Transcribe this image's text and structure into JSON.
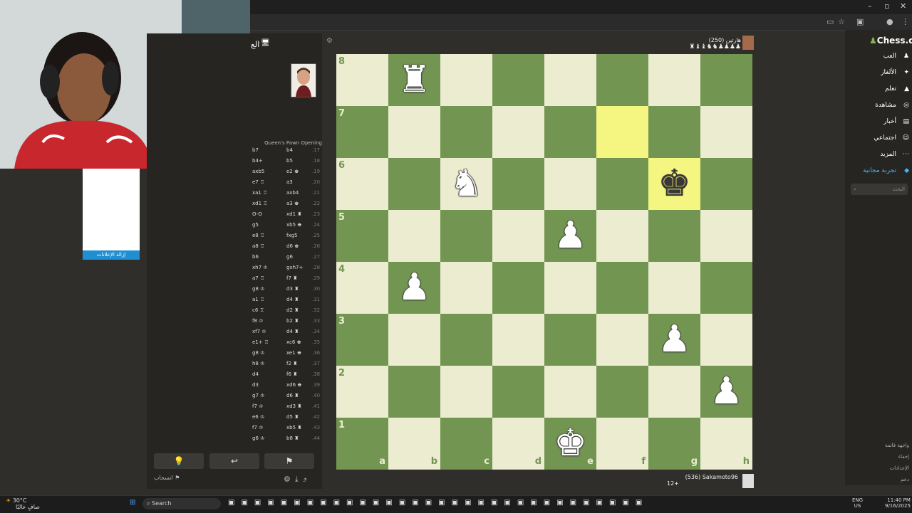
{
  "opponent": {
    "name": "هارتين (250)",
    "captured": "♜♝♝♞♞♟♟♟♟"
  },
  "player": {
    "name": "(536) Sakamoto96",
    "rating_note": "12+"
  },
  "opening_name": "Queen's Pawn Opening",
  "panel_title": "الع",
  "ad_button": "إزالة الإعلانات",
  "moves": [
    {
      "n": ".17",
      "w": "b4",
      "b": "b7"
    },
    {
      "n": ".18",
      "w": "b5",
      "b": "b4+"
    },
    {
      "n": ".19",
      "w": "e2 ♚",
      "b": "axb5"
    },
    {
      "n": ".20",
      "w": "a3",
      "b": "e7 ♖"
    },
    {
      "n": ".21",
      "w": "axb4",
      "b": "xa1 ♖"
    },
    {
      "n": ".22",
      "w": "a3 ♚",
      "b": "xd1 ♖"
    },
    {
      "n": ".23",
      "w": "xd1 ♜",
      "b": "O-O"
    },
    {
      "n": ".24",
      "w": "xb5 ♚",
      "b": "g5"
    },
    {
      "n": ".25",
      "w": "fxg5",
      "b": "e8 ♖"
    },
    {
      "n": ".26",
      "w": "d6 ♚",
      "b": "a8 ♖"
    },
    {
      "n": ".27",
      "w": "g6",
      "b": "b6"
    },
    {
      "n": ".28",
      "w": "gxh7+",
      "b": "xh7 ♔"
    },
    {
      "n": ".29",
      "w": "f7 ♜",
      "b": "a7 ♖"
    },
    {
      "n": ".30",
      "w": "d3 ♜",
      "b": "g8 ♔"
    },
    {
      "n": ".31",
      "w": "d4 ♜",
      "b": "a1 ♖"
    },
    {
      "n": ".32",
      "w": "d2 ♜",
      "b": "c6 ♖"
    },
    {
      "n": ".33",
      "w": "b2 ♜",
      "b": "f8 ♔"
    },
    {
      "n": ".34",
      "w": "d4 ♜",
      "b": "xf7 ♔"
    },
    {
      "n": ".35",
      "w": "xc6 ♚",
      "b": "e1+ ♖"
    },
    {
      "n": ".36",
      "w": "xe1 ♚",
      "b": "g8 ♔"
    },
    {
      "n": ".37",
      "w": "f2 ♜",
      "b": "h8 ♔"
    },
    {
      "n": ".38",
      "w": "f6 ♜",
      "b": "d4"
    },
    {
      "n": ".39",
      "w": "xd6 ♚",
      "b": "d3"
    },
    {
      "n": ".40",
      "w": "d6 ♜",
      "b": "g7 ♔"
    },
    {
      "n": ".41",
      "w": "xd3 ♜",
      "b": "f7 ♔"
    },
    {
      "n": ".42",
      "w": "d5 ♜",
      "b": "e6 ♔"
    },
    {
      "n": ".43",
      "w": "xb5 ♜",
      "b": "f7 ♔"
    },
    {
      "n": ".44",
      "w": "b8 ♜",
      "b": "g6 ♔"
    }
  ],
  "controls": {
    "resign": "انسحاب",
    "hint_icon": "lightbulb-icon",
    "undo_icon": "undo-icon",
    "flag_icon": "flag-icon"
  },
  "board": {
    "ranks": [
      "8",
      "7",
      "6",
      "5",
      "4",
      "3",
      "2",
      "1"
    ],
    "files": [
      "a",
      "b",
      "c",
      "d",
      "e",
      "f",
      "g",
      "h"
    ],
    "highlight": [
      "f7",
      "g6"
    ],
    "pieces": [
      {
        "sq": "b8",
        "glyph": "♜",
        "color": "white"
      },
      {
        "sq": "c6",
        "glyph": "♞",
        "color": "white"
      },
      {
        "sq": "g6",
        "glyph": "♚",
        "color": "black"
      },
      {
        "sq": "e5",
        "glyph": "♟",
        "color": "white"
      },
      {
        "sq": "b4",
        "glyph": "♟",
        "color": "white"
      },
      {
        "sq": "g3",
        "glyph": "♟",
        "color": "white"
      },
      {
        "sq": "h2",
        "glyph": "♟",
        "color": "white"
      },
      {
        "sq": "e1",
        "glyph": "♚",
        "color": "white"
      }
    ],
    "light_color": "#ebecd0",
    "dark_color": "#739552",
    "highlight_color": "#f5f682"
  },
  "nav": {
    "logo": "Chess.com",
    "items": [
      {
        "label": "العب",
        "icon": "pawn-icon"
      },
      {
        "label": "الألغاز",
        "icon": "puzzle-icon"
      },
      {
        "label": "تعلم",
        "icon": "learn-icon"
      },
      {
        "label": "مشاهدة",
        "icon": "binoculars-icon"
      },
      {
        "label": "أخبار",
        "icon": "news-icon"
      },
      {
        "label": "اجتماعي",
        "icon": "social-icon"
      },
      {
        "label": "المزيد",
        "icon": "more-icon"
      },
      {
        "label": "تجربة مجانية",
        "icon": "diamond-icon"
      }
    ],
    "search_placeholder": "البحث",
    "bottom": [
      "واجهة قاتمة",
      "إخفاء",
      "الإعدادات",
      "دعم"
    ]
  },
  "taskbar": {
    "weather": "30°C",
    "weather_sub": "صافٍ غالبًا",
    "search": "Search",
    "lang": "ENG",
    "lang_sub": "US",
    "time": "11:40 PM",
    "date": "9/16/2025"
  }
}
